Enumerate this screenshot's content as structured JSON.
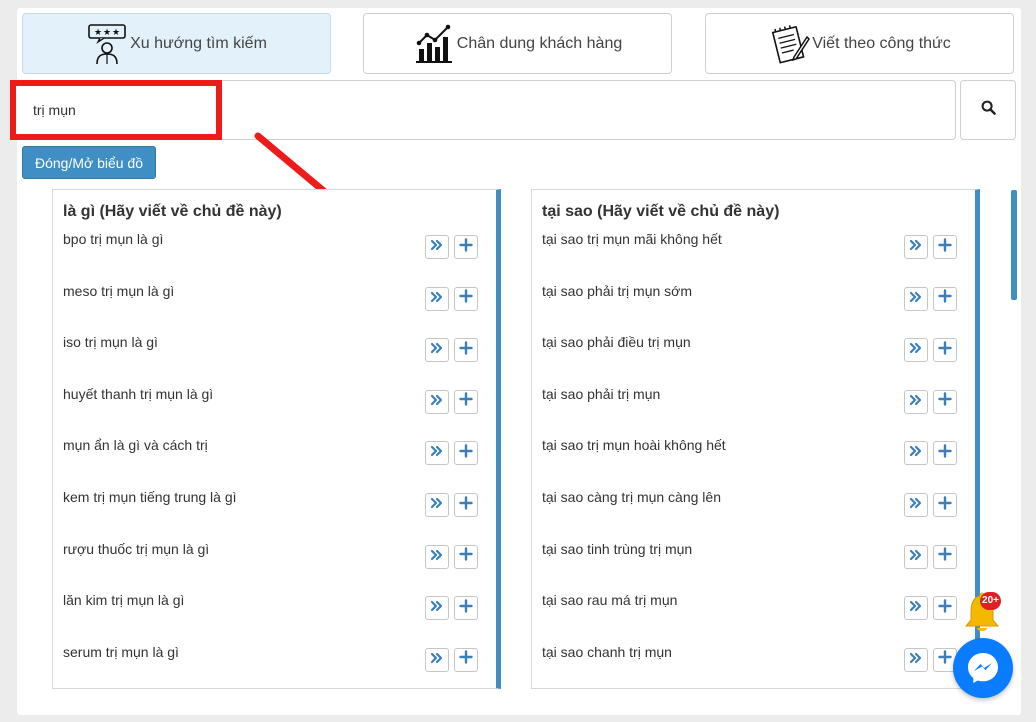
{
  "tabs": [
    {
      "label": "Xu hướng tìm kiếm",
      "icon": "rating-person-icon",
      "active": true
    },
    {
      "label": "Chân dung khách hàng",
      "icon": "bar-chart-growth-icon",
      "active": false
    },
    {
      "label": "Viết theo công thức",
      "icon": "notepad-pen-icon",
      "active": false
    }
  ],
  "search": {
    "value": "trị mụn",
    "icon": "search-icon"
  },
  "toggle_chart_label": "Đóng/Mở biểu đồ",
  "cards": [
    {
      "title": "là gì (Hãy viết về chủ đề này)",
      "items": [
        "bpo trị mụn là gì",
        "meso trị mụn là gì",
        "iso trị mụn là gì",
        "huyết thanh trị mụn là gì",
        "mụn ẩn là gì và cách trị",
        "kem trị mụn tiếng trung là gì",
        "rượu thuốc trị mụn là gì",
        "lăn kim trị mụn là gì",
        "serum trị mụn là gì"
      ]
    },
    {
      "title": "tại sao (Hãy viết về chủ đề này)",
      "items": [
        "tại sao trị mụn mãi không hết",
        "tại sao phải trị mụn sớm",
        "tại sao phải điều trị mụn",
        "tại sao phải trị mụn",
        "tại sao trị mụn hoài không hết",
        "tại sao càng trị mụn càng lên",
        "tại sao tinh trùng trị mụn",
        "tại sao rau má trị mụn",
        "tại sao chanh trị mụn"
      ]
    }
  ],
  "item_actions": {
    "expand_icon": "double-chevron-right-icon",
    "add_icon": "plus-icon"
  },
  "notification": {
    "badge": "20+",
    "icon": "bell-icon"
  },
  "messenger": {
    "icon": "messenger-icon"
  },
  "colors": {
    "accent": "#3f8fc4",
    "highlight": "#ee1b1b",
    "badge": "#e02020",
    "messenger": "#0a7cff"
  }
}
